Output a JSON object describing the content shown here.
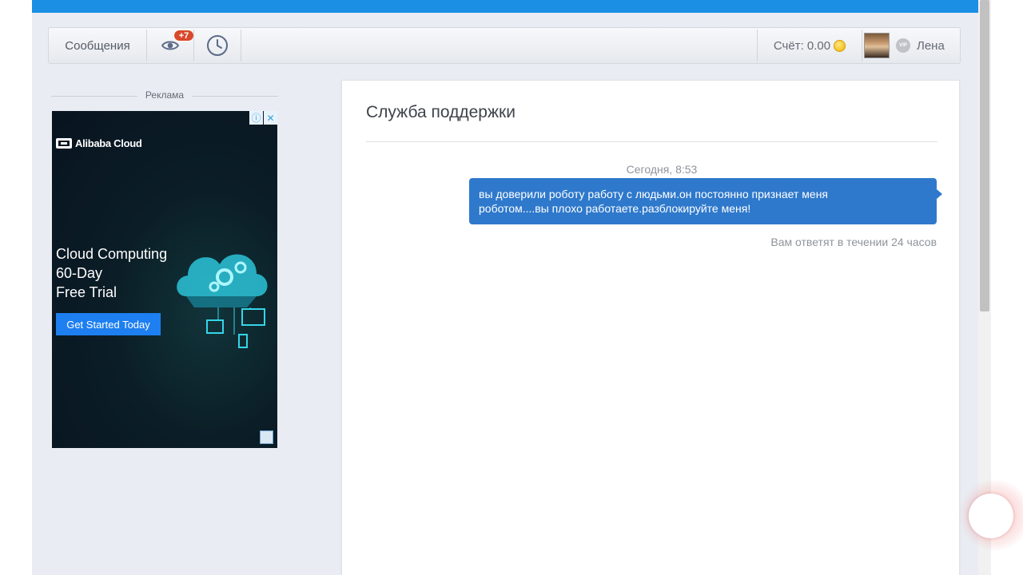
{
  "toolbar": {
    "messages_label": "Сообщения",
    "views_badge": "+7",
    "balance_label": "Счёт: 0.00",
    "user_name": "Лена",
    "vip_label": "VIP"
  },
  "sidebar": {
    "ad_label": "Реклама",
    "ad": {
      "brand": "Alibaba Cloud",
      "headline_lines": [
        "Cloud Computing",
        "60-Day",
        "Free Trial"
      ],
      "cta": "Get Started Today"
    }
  },
  "support": {
    "title": "Служба поддержки",
    "message_time": "Сегодня, 8:53",
    "message_lines": [
      "вы доверили роботу работу с людьми.он постоянно признает меня",
      "роботом....вы плохо работаете.разблокируйте меня!"
    ],
    "reply_note": "Вам ответят в течении 24 часов"
  },
  "colors": {
    "header_blue": "#1a8fe3",
    "bubble_blue": "#2f79cc",
    "badge_red": "#d9482b",
    "page_bg": "#e9edf3",
    "ad_cta_blue": "#1d7ff0"
  }
}
